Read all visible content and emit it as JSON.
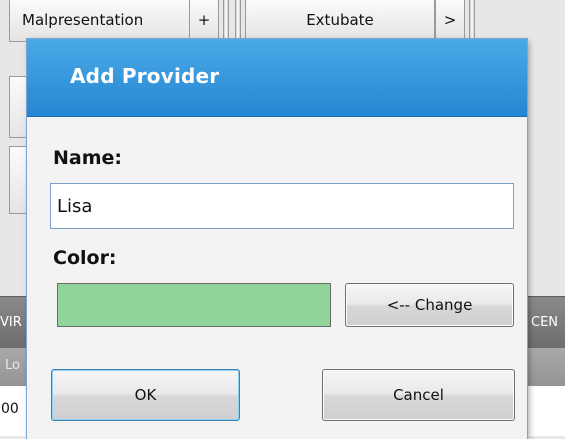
{
  "background": {
    "buttons": {
      "malpresentation": "Malpresentation",
      "plus": "+",
      "extubate": "Extubate",
      "next": ">"
    },
    "header_left": "VIR",
    "header_right": "CEN",
    "lower_left": "Lo",
    "bottom_left": "00"
  },
  "dialog": {
    "title": "Add Provider",
    "name_label": "Name:",
    "name_value": "Lisa",
    "color_label": "Color:",
    "selected_color": "#90d49a",
    "change_button": "<-- Change",
    "ok_button": "OK",
    "cancel_button": "Cancel"
  }
}
